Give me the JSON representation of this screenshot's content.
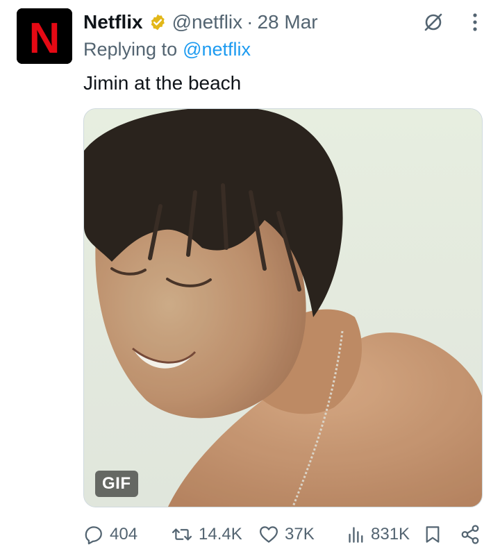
{
  "tweet": {
    "author_name": "Netflix",
    "handle": "@netflix",
    "separator": "·",
    "date": "28 Mar",
    "replying_prefix": "Replying to",
    "replying_handle": "@netflix",
    "text": "Jimin at the beach",
    "media": {
      "type": "gif",
      "badge": "GIF"
    },
    "avatar_logo": "N"
  },
  "actions": {
    "replies": "404",
    "reposts": "14.4K",
    "likes": "37K",
    "views": "831K"
  },
  "icons": {
    "verified": "verified-badge-icon",
    "grok": "grok-icon",
    "more": "more-options-icon",
    "reply": "reply-icon",
    "repost": "repost-icon",
    "like": "heart-icon",
    "views": "views-icon",
    "bookmark": "bookmark-icon",
    "share": "share-icon"
  },
  "colors": {
    "text": "#0f1419",
    "secondary": "#536471",
    "link": "#1d9bf0",
    "verified_gold": "#e2b719",
    "netflix_red": "#e50914"
  }
}
